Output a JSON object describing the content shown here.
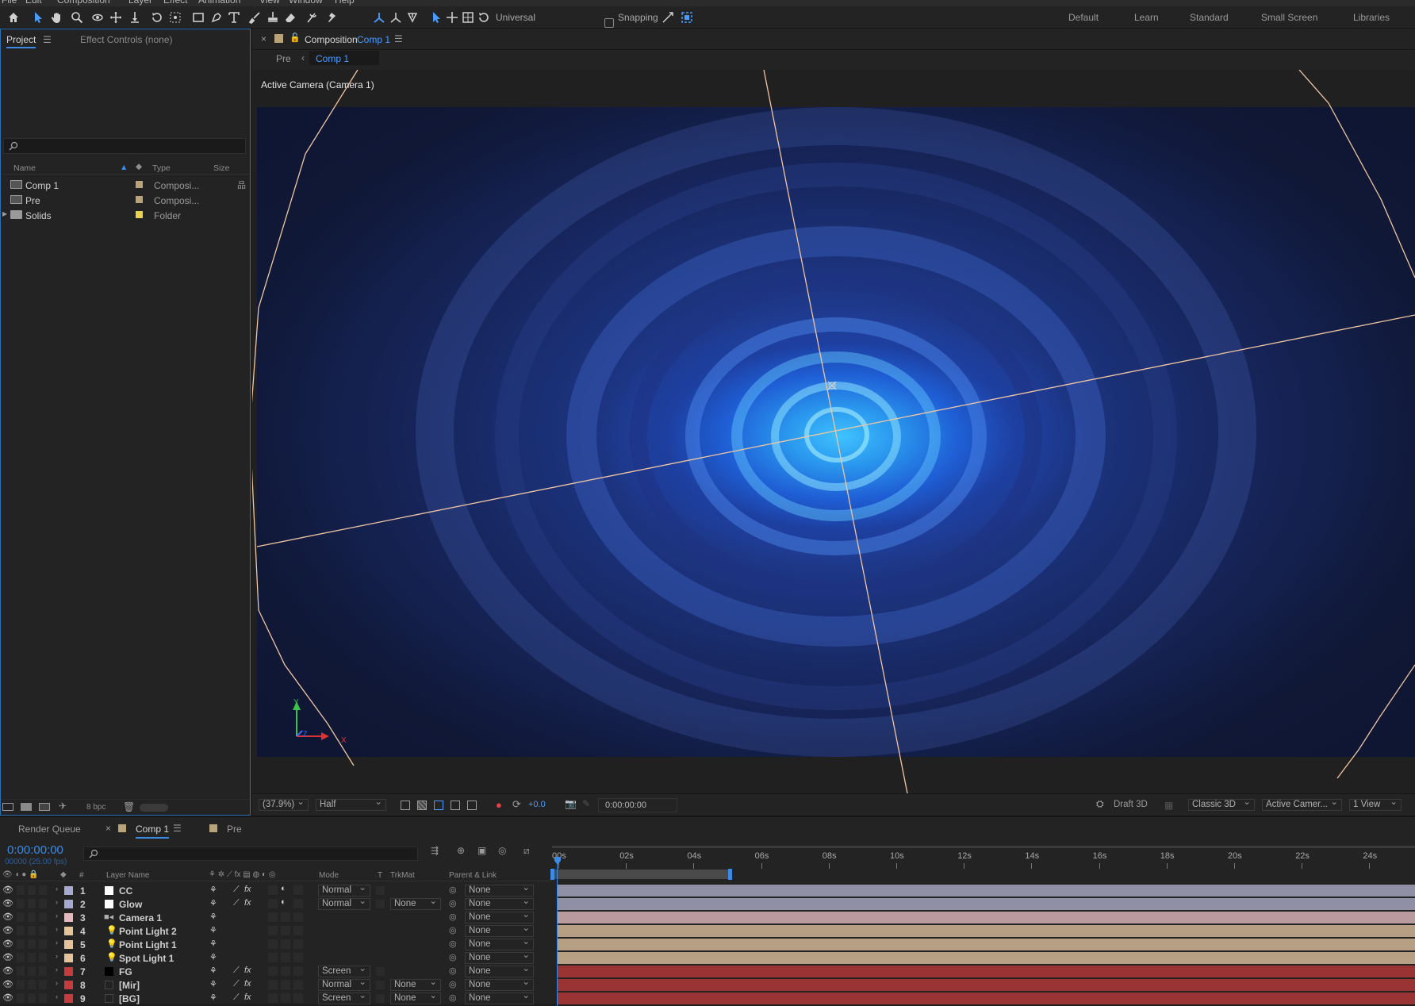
{
  "menu": [
    "File",
    "Edit",
    "Composition",
    "Layer",
    "Effect",
    "Animation",
    "View",
    "Window",
    "Help"
  ],
  "toolbar": {
    "universal": "Universal",
    "snapping": "Snapping"
  },
  "workspaces": [
    "Default",
    "Learn",
    "Standard",
    "Small Screen",
    "Libraries"
  ],
  "project": {
    "tab_project": "Project",
    "tab_effects": "Effect Controls (none)",
    "cols": {
      "name": "Name",
      "type": "Type",
      "size": "Size"
    },
    "items": [
      {
        "name": "Comp 1",
        "type": "Composi...",
        "label_color": "#b9a47a"
      },
      {
        "name": "Pre",
        "type": "Composi...",
        "label_color": "#b9a47a"
      },
      {
        "name": "Solids",
        "type": "Folder",
        "label_color": "#e8d24f"
      }
    ],
    "bpc": "8 bpc"
  },
  "comp": {
    "tab_prefix": "Composition",
    "tab_name": "Comp 1",
    "crumbs": [
      "Pre",
      "Comp 1"
    ],
    "camera_label": "Active Camera (Camera 1)",
    "axis_labels": {
      "y": "Y",
      "x": "X",
      "z": "Z"
    },
    "zoom": "(37.9%)",
    "resolution": "Half",
    "exposure": "+0.0",
    "timecode": "0:00:00:00",
    "draft": "Draft 3D",
    "renderer": "Classic 3D",
    "view": "Active Camer...",
    "layout": "1 View"
  },
  "timeline": {
    "tabs": {
      "render_queue": "Render Queue",
      "comp": "Comp 1",
      "pre": "Pre"
    },
    "timecode": "0:00:00:00",
    "frames": "00000 (25.00 fps)",
    "cols": {
      "hash": "#",
      "layer_name": "Layer Name",
      "mode": "Mode",
      "t": "T",
      "trkmat": "TrkMat",
      "parent": "Parent & Link"
    },
    "ruler": [
      "00s",
      "02s",
      "04s",
      "06s",
      "08s",
      "10s",
      "12s",
      "14s",
      "16s",
      "18s",
      "20s",
      "22s",
      "24s"
    ],
    "layers": [
      {
        "num": "1",
        "name": "CC",
        "label_color": "#a7a9cf",
        "kind": "solid-white",
        "mode": "Normal",
        "trkmat": "",
        "parent": "None",
        "fx": true,
        "adj": true,
        "bar_color": "#8f8fa5"
      },
      {
        "num": "2",
        "name": "Glow",
        "label_color": "#a7a9cf",
        "kind": "solid-white",
        "mode": "Normal",
        "trkmat": "None",
        "parent": "None",
        "fx": true,
        "adj": true,
        "bar_color": "#8f8fa5"
      },
      {
        "num": "3",
        "name": "Camera 1",
        "label_color": "#e7b7c0",
        "kind": "camera",
        "mode": "",
        "trkmat": "",
        "parent": "None",
        "fx": false,
        "adj": false,
        "bar_color": "#b99a9e"
      },
      {
        "num": "4",
        "name": "Point Light 2",
        "label_color": "#e6c49a",
        "kind": "light",
        "mode": "",
        "trkmat": "",
        "parent": "None",
        "fx": false,
        "adj": false,
        "bar_color": "#b79f84"
      },
      {
        "num": "5",
        "name": "Point Light 1",
        "label_color": "#e6c49a",
        "kind": "light",
        "mode": "",
        "trkmat": "",
        "parent": "None",
        "fx": false,
        "adj": false,
        "bar_color": "#b79f84"
      },
      {
        "num": "6",
        "name": "Spot Light 1",
        "label_color": "#e6c49a",
        "kind": "light",
        "mode": "",
        "trkmat": "",
        "parent": "None",
        "fx": false,
        "adj": false,
        "bar_color": "#b79f84"
      },
      {
        "num": "7",
        "name": "FG",
        "label_color": "#c43c3c",
        "kind": "solid-black",
        "mode": "Screen",
        "trkmat": "",
        "parent": "None",
        "fx": true,
        "adj": false,
        "bar_color": "#9a3333"
      },
      {
        "num": "8",
        "name": "[Mir]",
        "label_color": "#c43c3c",
        "kind": "precomp",
        "mode": "Normal",
        "trkmat": "None",
        "parent": "None",
        "fx": true,
        "adj": false,
        "bar_color": "#9a3333"
      },
      {
        "num": "9",
        "name": "[BG]",
        "label_color": "#c43c3c",
        "kind": "precomp",
        "mode": "Screen",
        "trkmat": "None",
        "parent": "None",
        "fx": true,
        "adj": false,
        "bar_color": "#9a3333"
      }
    ]
  }
}
